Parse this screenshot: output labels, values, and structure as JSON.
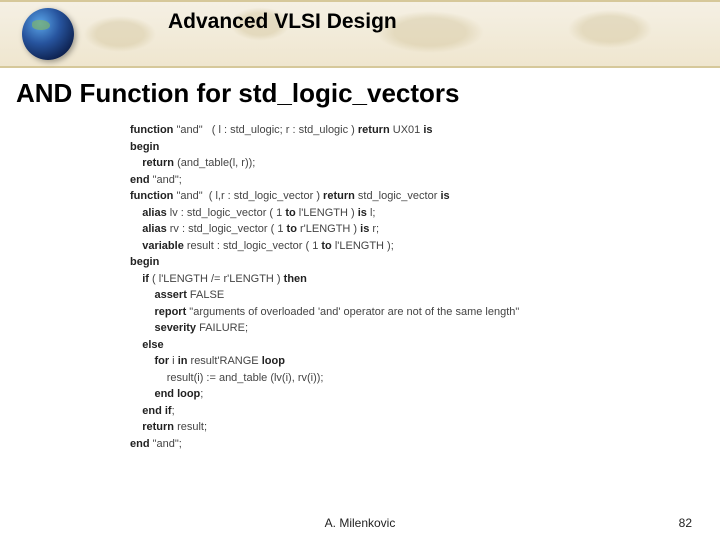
{
  "header": {
    "course_title": "Advanced VLSI Design"
  },
  "slide": {
    "title": "AND Function for std_logic_vectors"
  },
  "code": {
    "lines": [
      {
        "indent": 0,
        "segs": [
          {
            "t": "function",
            "kw": true
          },
          {
            "t": " \"and\"   ( l : std_ulogic; r : std_ulogic ) "
          },
          {
            "t": "return",
            "kw": true
          },
          {
            "t": " UX01 "
          },
          {
            "t": "is",
            "kw": true
          }
        ]
      },
      {
        "indent": 0,
        "segs": [
          {
            "t": "begin",
            "kw": true
          }
        ]
      },
      {
        "indent": 1,
        "segs": [
          {
            "t": "return",
            "kw": true
          },
          {
            "t": " (and_table(l, r));"
          }
        ]
      },
      {
        "indent": 0,
        "segs": [
          {
            "t": "end",
            "kw": true
          },
          {
            "t": " \"and\";"
          }
        ]
      },
      {
        "indent": 0,
        "segs": [
          {
            "t": ""
          }
        ]
      },
      {
        "indent": 0,
        "segs": [
          {
            "t": "function",
            "kw": true
          },
          {
            "t": " \"and\"  ( l,r : std_logic_vector ) "
          },
          {
            "t": "return",
            "kw": true
          },
          {
            "t": " std_logic_vector "
          },
          {
            "t": "is",
            "kw": true
          }
        ]
      },
      {
        "indent": 1,
        "segs": [
          {
            "t": "alias",
            "kw": true
          },
          {
            "t": " lv : std_logic_vector ( 1 "
          },
          {
            "t": "to",
            "kw": true
          },
          {
            "t": " l'LENGTH ) "
          },
          {
            "t": "is",
            "kw": true
          },
          {
            "t": " l;"
          }
        ]
      },
      {
        "indent": 1,
        "segs": [
          {
            "t": "alias",
            "kw": true
          },
          {
            "t": " rv : std_logic_vector ( 1 "
          },
          {
            "t": "to",
            "kw": true
          },
          {
            "t": " r'LENGTH ) "
          },
          {
            "t": "is",
            "kw": true
          },
          {
            "t": " r;"
          }
        ]
      },
      {
        "indent": 1,
        "segs": [
          {
            "t": "variable",
            "kw": true
          },
          {
            "t": " result : std_logic_vector ( 1 "
          },
          {
            "t": "to",
            "kw": true
          },
          {
            "t": " l'LENGTH );"
          }
        ]
      },
      {
        "indent": 0,
        "segs": [
          {
            "t": "begin",
            "kw": true
          }
        ]
      },
      {
        "indent": 1,
        "segs": [
          {
            "t": "if",
            "kw": true
          },
          {
            "t": " ( l'LENGTH /= r'LENGTH ) "
          },
          {
            "t": "then",
            "kw": true
          }
        ]
      },
      {
        "indent": 2,
        "segs": [
          {
            "t": "assert",
            "kw": true
          },
          {
            "t": " FALSE"
          }
        ]
      },
      {
        "indent": 2,
        "segs": [
          {
            "t": "report",
            "kw": true
          },
          {
            "t": " \"arguments of overloaded 'and' operator are not of the same length\""
          }
        ]
      },
      {
        "indent": 2,
        "segs": [
          {
            "t": "severity",
            "kw": true
          },
          {
            "t": " FAILURE;"
          }
        ]
      },
      {
        "indent": 1,
        "segs": [
          {
            "t": "else",
            "kw": true
          }
        ]
      },
      {
        "indent": 2,
        "segs": [
          {
            "t": "for",
            "kw": true
          },
          {
            "t": " i "
          },
          {
            "t": "in",
            "kw": true
          },
          {
            "t": " result'RANGE "
          },
          {
            "t": "loop",
            "kw": true
          }
        ]
      },
      {
        "indent": 3,
        "segs": [
          {
            "t": "result(i) := and_table (lv(i), rv(i));"
          }
        ]
      },
      {
        "indent": 2,
        "segs": [
          {
            "t": "end loop",
            "kw": true
          },
          {
            "t": ";"
          }
        ]
      },
      {
        "indent": 1,
        "segs": [
          {
            "t": "end if",
            "kw": true
          },
          {
            "t": ";"
          }
        ]
      },
      {
        "indent": 1,
        "segs": [
          {
            "t": "return",
            "kw": true
          },
          {
            "t": " result;"
          }
        ]
      },
      {
        "indent": 0,
        "segs": [
          {
            "t": "end",
            "kw": true
          },
          {
            "t": " \"and\";"
          }
        ]
      }
    ]
  },
  "footer": {
    "author": "  A. Milenkovic",
    "page_number": "82"
  }
}
